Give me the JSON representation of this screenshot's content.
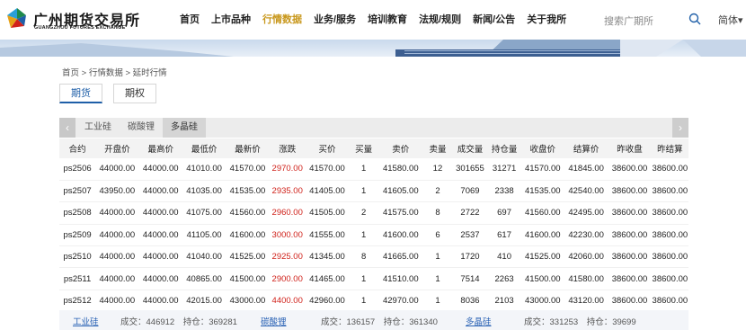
{
  "header": {
    "logo_cn": "广州期货交易所",
    "logo_en": "GUANGZHOU FUTURES EXCHANGE",
    "nav": [
      "首页",
      "上市品种",
      "行情数据",
      "业务/服务",
      "培训教育",
      "法规/规则",
      "新闻/公告",
      "关于我所"
    ],
    "active_nav": "行情数据",
    "search_placeholder": "搜索广期所",
    "lang": "简体▾"
  },
  "breadcrumb": "首页 > 行情数据 > 延时行情",
  "tabs": [
    "期货",
    "期权"
  ],
  "active_tab": "期货",
  "subtabs": [
    "工业硅",
    "碳酸锂",
    "多晶硅"
  ],
  "active_subtab": "多晶硅",
  "table": {
    "columns": [
      "合约",
      "开盘价",
      "最高价",
      "最低价",
      "最新价",
      "涨跌",
      "买价",
      "买量",
      "卖价",
      "卖量",
      "成交量",
      "持仓量",
      "收盘价",
      "结算价",
      "昨收盘",
      "昨结算"
    ],
    "rows": [
      [
        "ps2506",
        "44000.00",
        "44000.00",
        "41010.00",
        "41570.00",
        "2970.00",
        "41570.00",
        "1",
        "41580.00",
        "12",
        "301655",
        "31271",
        "41570.00",
        "41845.00",
        "38600.00",
        "38600.00"
      ],
      [
        "ps2507",
        "43950.00",
        "44000.00",
        "41035.00",
        "41535.00",
        "2935.00",
        "41405.00",
        "1",
        "41605.00",
        "2",
        "7069",
        "2338",
        "41535.00",
        "42540.00",
        "38600.00",
        "38600.00"
      ],
      [
        "ps2508",
        "44000.00",
        "44000.00",
        "41075.00",
        "41560.00",
        "2960.00",
        "41505.00",
        "2",
        "41575.00",
        "8",
        "2722",
        "697",
        "41560.00",
        "42495.00",
        "38600.00",
        "38600.00"
      ],
      [
        "ps2509",
        "44000.00",
        "44000.00",
        "41105.00",
        "41600.00",
        "3000.00",
        "41555.00",
        "1",
        "41600.00",
        "6",
        "2537",
        "617",
        "41600.00",
        "42230.00",
        "38600.00",
        "38600.00"
      ],
      [
        "ps2510",
        "44000.00",
        "44000.00",
        "41040.00",
        "41525.00",
        "2925.00",
        "41345.00",
        "8",
        "41665.00",
        "1",
        "1720",
        "410",
        "41525.00",
        "42060.00",
        "38600.00",
        "38600.00"
      ],
      [
        "ps2511",
        "44000.00",
        "44000.00",
        "40865.00",
        "41500.00",
        "2900.00",
        "41465.00",
        "1",
        "41510.00",
        "1",
        "7514",
        "2263",
        "41500.00",
        "41580.00",
        "38600.00",
        "38600.00"
      ],
      [
        "ps2512",
        "44000.00",
        "44000.00",
        "42015.00",
        "43000.00",
        "4400.00",
        "42960.00",
        "1",
        "42970.00",
        "1",
        "8036",
        "2103",
        "43000.00",
        "43120.00",
        "38600.00",
        "38600.00"
      ]
    ]
  },
  "summary": [
    {
      "name": "工业硅",
      "stats": "成交：446912　持仓：369281"
    },
    {
      "name": "碳酸锂",
      "stats": "成交：136157　持仓：361340"
    },
    {
      "name": "多晶硅",
      "stats": "成交：331253　持仓：39699"
    }
  ],
  "colors": {
    "accent_gold": "#c8971b",
    "link_blue": "#2b63b5",
    "up_red": "#d0221b",
    "tab_blue": "#1f5fa8"
  }
}
